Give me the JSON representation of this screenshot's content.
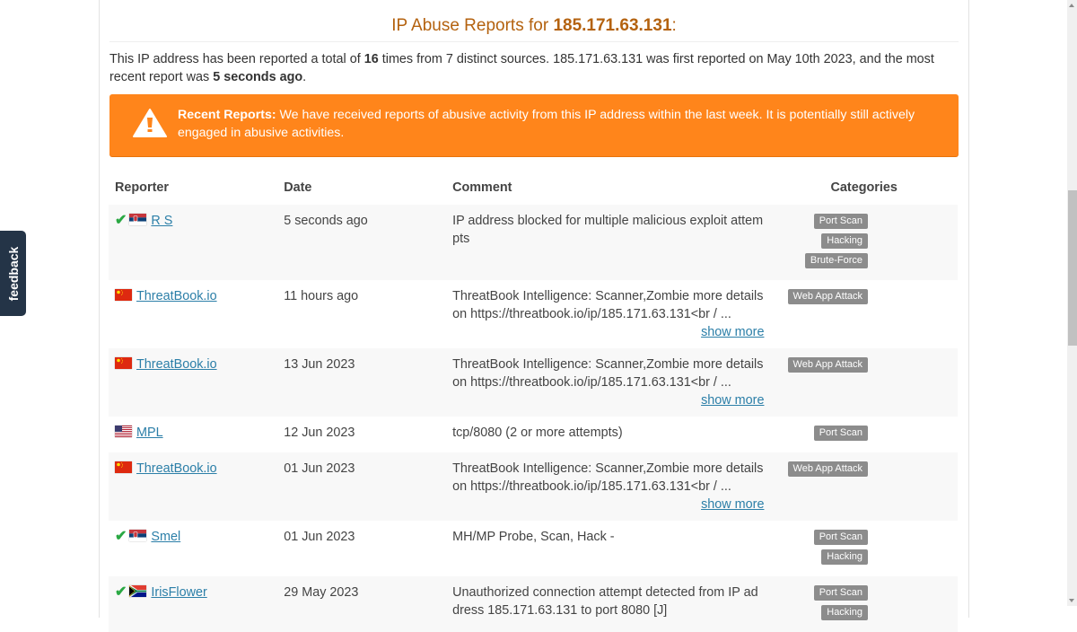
{
  "page": {
    "title_prefix": "IP Abuse Reports for ",
    "ip": "185.171.63.131",
    "title_suffix": ":"
  },
  "summary": {
    "part1": "This IP address has been reported a total of ",
    "total_reports": "16",
    "part2": " times from 7 distinct sources. 185.171.63.131 was first reported on May 10th 2023, and the most recent report was ",
    "most_recent": "5 seconds ago",
    "part3": "."
  },
  "alert": {
    "icon": "warning-triangle-icon",
    "color": "#ff851b",
    "heading": "Recent Reports:",
    "text": " We have received reports of abusive activity from this IP address within the last week. It is potentially still actively engaged in abusive activities."
  },
  "table": {
    "headers": {
      "reporter": "Reporter",
      "date": "Date",
      "comment": "Comment",
      "categories": "Categories"
    },
    "show_more_label": "show more",
    "rows": [
      {
        "verified": true,
        "flag": "serbia",
        "reporter": "R S",
        "date": "5 seconds ago",
        "comment": "IP address blocked for multiple malicious exploit attempts",
        "show_more": false,
        "categories": [
          "Port Scan",
          "Hacking",
          "Brute-Force"
        ]
      },
      {
        "verified": false,
        "flag": "china",
        "reporter": "ThreatBook.io",
        "date": "11 hours ago",
        "comment": "ThreatBook Intelligence: Scanner,Zombie more details on https://threatbook.io/ip/185.171.63.131<br / ...",
        "show_more": true,
        "categories": [
          "Web App Attack"
        ]
      },
      {
        "verified": false,
        "flag": "china",
        "reporter": "ThreatBook.io",
        "date": "13 Jun 2023",
        "comment": "ThreatBook Intelligence: Scanner,Zombie more details on https://threatbook.io/ip/185.171.63.131<br / ...",
        "show_more": true,
        "categories": [
          "Web App Attack"
        ]
      },
      {
        "verified": false,
        "flag": "usa",
        "reporter": "MPL",
        "date": "12 Jun 2023",
        "comment": "tcp/8080 (2 or more attempts)",
        "show_more": false,
        "categories": [
          "Port Scan"
        ]
      },
      {
        "verified": false,
        "flag": "china",
        "reporter": "ThreatBook.io",
        "date": "01 Jun 2023",
        "comment": "ThreatBook Intelligence: Scanner,Zombie more details on https://threatbook.io/ip/185.171.63.131<br / ...",
        "show_more": true,
        "categories": [
          "Web App Attack"
        ]
      },
      {
        "verified": true,
        "flag": "serbia",
        "reporter": "Smel",
        "date": "01 Jun 2023",
        "comment": "MH/MP Probe, Scan, Hack -",
        "show_more": false,
        "categories": [
          "Port Scan",
          "Hacking"
        ]
      },
      {
        "verified": true,
        "flag": "south-africa",
        "reporter": "IrisFlower",
        "date": "29 May 2023",
        "comment": "Unauthorized connection attempt detected from IP address 185.171.63.131 to port 8080 [J]",
        "show_more": false,
        "categories": [
          "Port Scan",
          "Hacking"
        ]
      }
    ]
  },
  "feedback": {
    "label": "feedback"
  },
  "colors": {
    "title": "#b4620f",
    "link": "#2c7fa8",
    "badge": "#8c8c8c",
    "verified": "#2aa843",
    "feedback_bg": "#243447"
  }
}
